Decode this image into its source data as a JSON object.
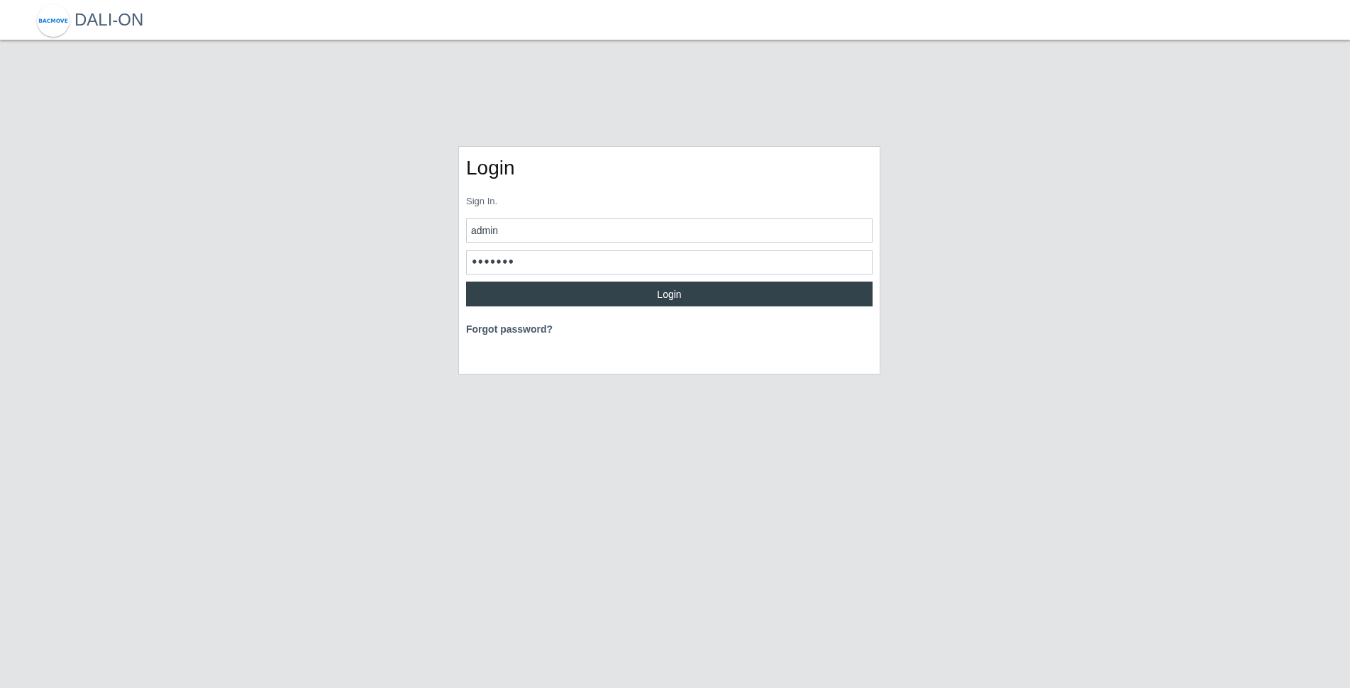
{
  "header": {
    "logo_text": "BACMOVE",
    "title": "DALI-ON"
  },
  "login": {
    "title": "Login",
    "subtitle": "Sign In.",
    "fields": [
      {
        "kind": "text",
        "value": "admin"
      },
      {
        "kind": "password",
        "value": "•••••••"
      }
    ],
    "button": "Login",
    "link": "Forgot password?"
  }
}
